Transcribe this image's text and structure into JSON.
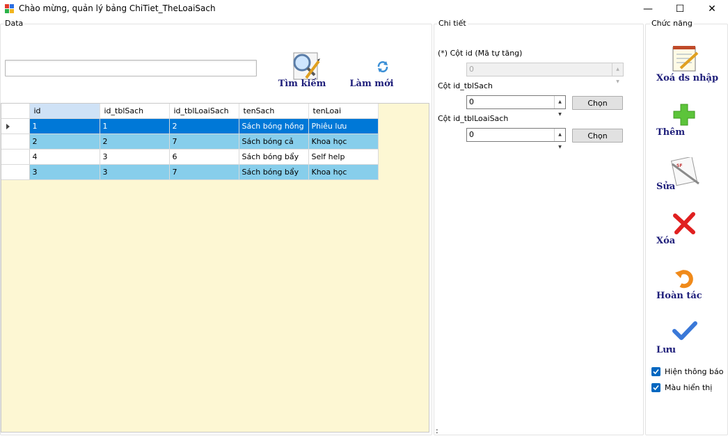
{
  "window": {
    "title": "Chào mừng, quản lý bảng ChiTiet_TheLoaiSach",
    "minimize": "—",
    "maximize": "☐",
    "close": "✕"
  },
  "groups": {
    "data_label": "Data",
    "chitiet_label": "Chi tiết",
    "chucnang_label": "Chức năng"
  },
  "search": {
    "value": "",
    "search_label": "Tìm kiếm",
    "refresh_label": "Làm mới"
  },
  "grid": {
    "columns": [
      "id",
      "id_tblSach",
      "id_tblLoaiSach",
      "tenSach",
      "tenLoai"
    ],
    "rows": [
      [
        "1",
        "1",
        "2",
        "Sách bóng hồng",
        "Phiêu lưu"
      ],
      [
        "2",
        "2",
        "7",
        "Sách bóng cả",
        "Khoa học"
      ],
      [
        "4",
        "3",
        "6",
        "Sách bóng bẩy",
        "Self help"
      ],
      [
        "3",
        "3",
        "7",
        "Sách bóng bẩy",
        "Khoa học"
      ]
    ]
  },
  "details": {
    "id_label": "(*) Cột id (Mã tự tăng)",
    "id_value": "0",
    "sach_label": "Cột id_tblSach",
    "sach_value": "0",
    "loaisach_label": "Cột id_tblLoaiSach",
    "loaisach_value": "0",
    "chon_label": "Chọn",
    "status": ":"
  },
  "functions": {
    "clear_label": "Xoá ds nhập",
    "add_label": "Thêm",
    "edit_label": "Sửa",
    "delete_label": "Xóa",
    "undo_label": "Hoàn tác",
    "save_label": "Lưu",
    "show_message_label": "Hiện thông báo",
    "show_color_label": "Màu hiển thị"
  },
  "colors": {
    "selected_row": "#0078d7",
    "alt_row": "#87ceeb",
    "grid_background": "#fdf7d3",
    "button_text": "#1e1e7a",
    "checkbox": "#0067c0"
  }
}
